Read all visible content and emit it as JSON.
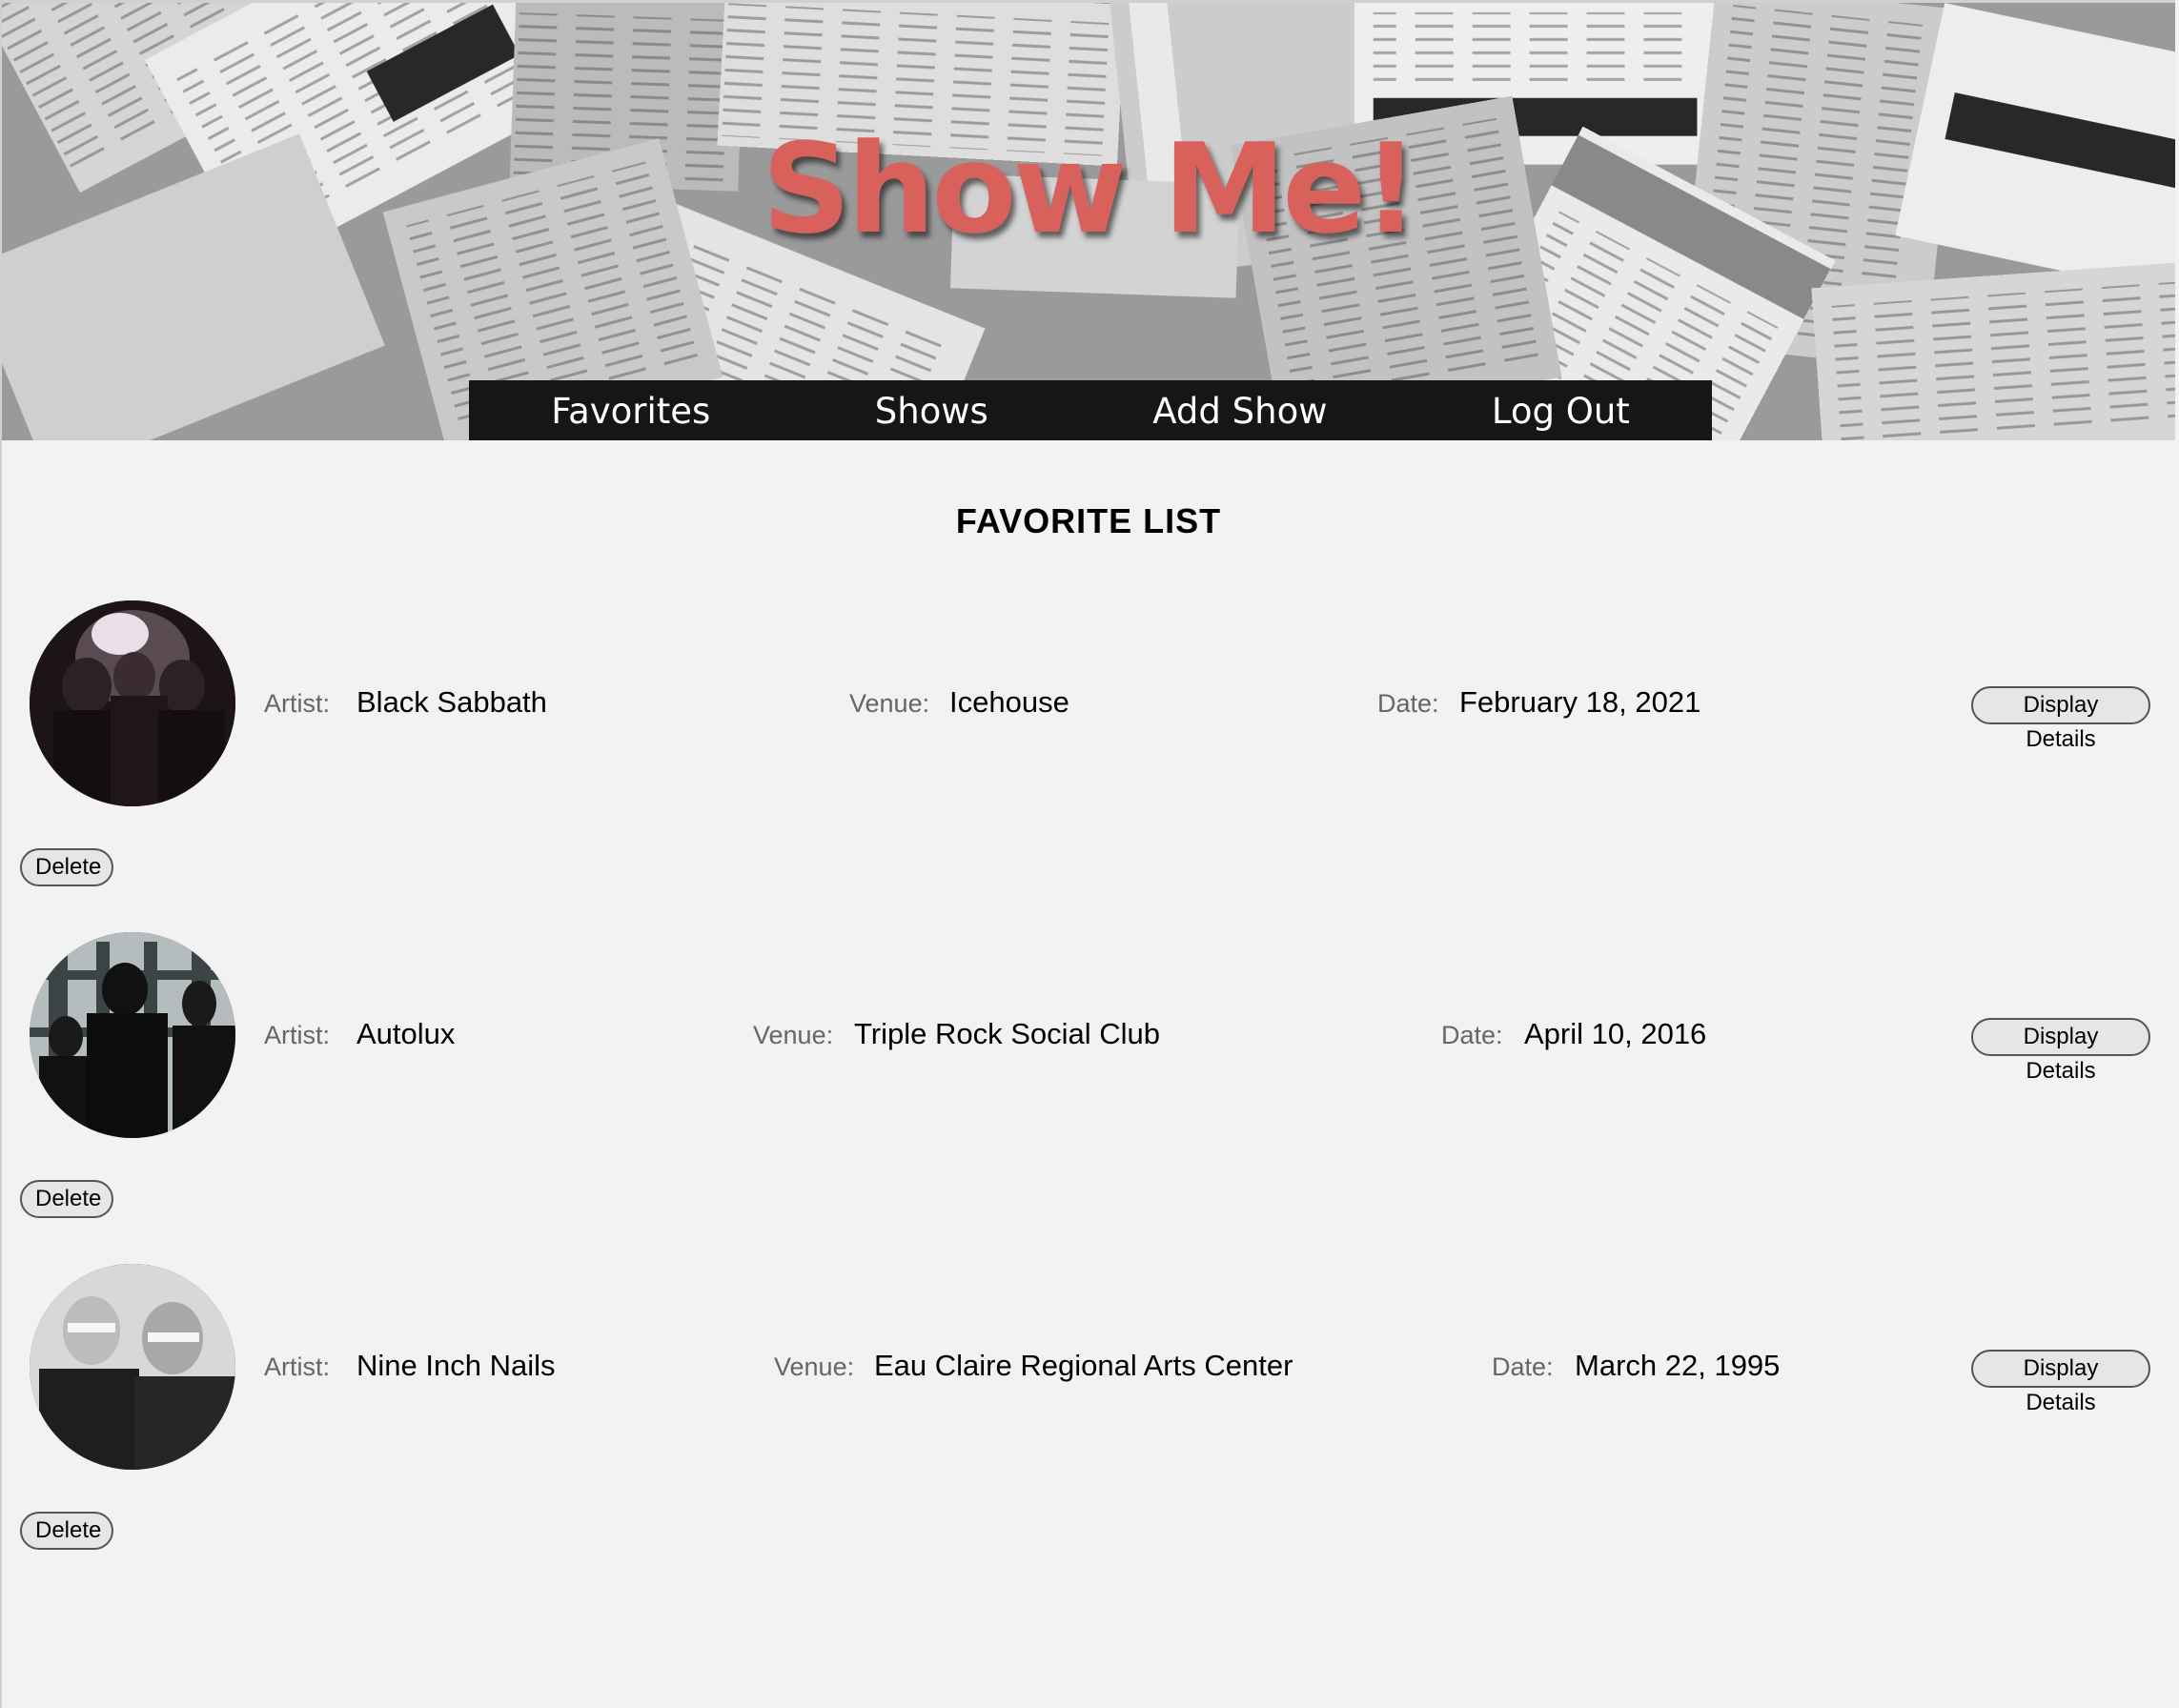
{
  "header": {
    "brand": "Show Me!",
    "nav": [
      {
        "label": "Favorites"
      },
      {
        "label": "Shows"
      },
      {
        "label": "Add Show"
      },
      {
        "label": "Log Out"
      }
    ]
  },
  "main": {
    "title": "FAVORITE LIST",
    "labels": {
      "artist": "Artist:",
      "venue": "Venue:",
      "date": "Date:",
      "details_button": "Display Details",
      "delete_button": "Delete"
    },
    "favorites": [
      {
        "artist": "Black Sabbath",
        "venue": "Icehouse",
        "date": "February 18, 2021"
      },
      {
        "artist": "Autolux",
        "venue": "Triple Rock Social Club",
        "date": "April 10, 2016"
      },
      {
        "artist": "Nine Inch Nails",
        "venue": "Eau Claire Regional Arts Center",
        "date": "March 22, 1995"
      }
    ]
  },
  "colors": {
    "brand": "#d9615c",
    "navbar": "#161616",
    "page_bg": "#f2f2f2"
  }
}
